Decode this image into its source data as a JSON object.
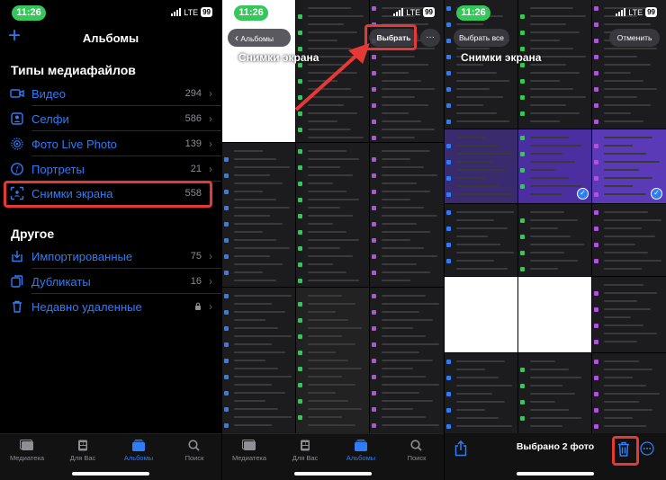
{
  "status": {
    "time": "11:26",
    "network": "LTE",
    "battery": "99"
  },
  "panel1": {
    "title": "Альбомы",
    "media_header": "Типы медиафайлов",
    "media": [
      {
        "label": "Видео",
        "count": "294",
        "icon": "video-icon"
      },
      {
        "label": "Селфи",
        "count": "586",
        "icon": "selfie-icon"
      },
      {
        "label": "Фото Live Photo",
        "count": "139",
        "icon": "live-photo-icon"
      },
      {
        "label": "Портреты",
        "count": "21",
        "icon": "portrait-icon"
      },
      {
        "label": "Снимки экрана",
        "count": "558",
        "icon": "screenshot-icon"
      }
    ],
    "other_header": "Другое",
    "other": [
      {
        "label": "Импортированные",
        "count": "75",
        "icon": "import-icon"
      },
      {
        "label": "Дубликаты",
        "count": "16",
        "icon": "duplicates-icon"
      },
      {
        "label": "Недавно удаленные",
        "count": "",
        "icon": "trash-icon"
      }
    ]
  },
  "tabs": [
    {
      "label": "Медиатека",
      "icon": "photo-library-icon"
    },
    {
      "label": "Для Вас",
      "icon": "for-you-icon"
    },
    {
      "label": "Альбомы",
      "icon": "albums-icon"
    },
    {
      "label": "Поиск",
      "icon": "search-icon"
    }
  ],
  "panel2": {
    "back_label": "Альбомы",
    "album_title": "Снимки экрана",
    "select_label": "Выбрать",
    "more": "···"
  },
  "panel3": {
    "select_all_label": "Выбрать все",
    "album_title": "Снимки экрана",
    "cancel_label": "Отменить",
    "selected_text": "Выбрано 2 фото",
    "more": "···"
  },
  "colors": {
    "accent": "#2f7cf6",
    "highlight": "#e53935",
    "status_green": "#34c759"
  }
}
